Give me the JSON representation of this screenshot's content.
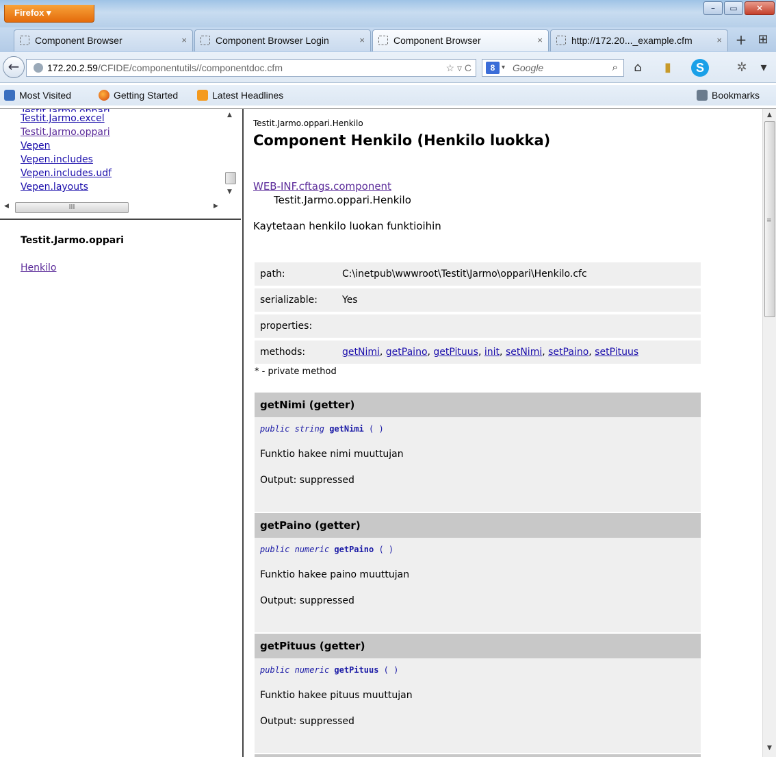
{
  "browser": {
    "menu_button": "Firefox ▾",
    "window_controls": {
      "minimize": "–",
      "maximize": "▭",
      "close": "✕"
    }
  },
  "tabs": [
    {
      "label": "Component Browser",
      "close": "×"
    },
    {
      "label": "Component Browser Login",
      "close": "×"
    },
    {
      "label": "Component Browser",
      "close": "×"
    },
    {
      "label": "http://172.20..._example.cfm",
      "close": "×"
    }
  ],
  "tab_actions": {
    "new_tab": "+",
    "tab_list": "⊞"
  },
  "navbar": {
    "back": "←",
    "url_host": "172.20.2.59",
    "url_path": "/CFIDE/componentutils//componentdoc.cfm",
    "url_icons": "☆ ▿ C",
    "search_engine": "8",
    "search_caret": "▾",
    "search_placeholder": "Google",
    "search_go": "⌕",
    "home": "⌂",
    "bookmark": "▮",
    "skype": "S",
    "ext": "✲",
    "menu_caret": "▾"
  },
  "bookmarks_bar": {
    "most_visited": "Most Visited",
    "getting_started": "Getting Started",
    "latest_headlines": "Latest Headlines",
    "bookmarks": "Bookmarks"
  },
  "packages": [
    {
      "label": "Testit.Jarmo.excel",
      "visited": false
    },
    {
      "label": "Testit.Jarmo.oppari",
      "visited": true
    },
    {
      "label": "Vepen",
      "visited": false
    },
    {
      "label": "Vepen.includes",
      "visited": false
    },
    {
      "label": "Vepen.includes.udf",
      "visited": false
    },
    {
      "label": "Vepen.layouts",
      "visited": false
    }
  ],
  "scroll_glyphs": {
    "up": "▲",
    "down": "▼",
    "left": "◀",
    "right": "▶",
    "grip": "III",
    "vgrip": "≡"
  },
  "class_frame": {
    "package_title": "Testit.Jarmo.oppari",
    "component_link": "Henkilo"
  },
  "doc": {
    "package": "Testit.Jarmo.oppari.Henkilo",
    "title": "Component Henkilo (Henkilo luokka)",
    "parent_link": "WEB-INF.cftags.component",
    "fqcn": "Testit.Jarmo.oppari.Henkilo",
    "description": "Kaytetaan henkilo luokan funktioihin",
    "properties_table": {
      "path_label": "path:",
      "path_value": "C:\\inetpub\\wwwroot\\Testit\\Jarmo\\oppari\\Henkilo.cfc",
      "serializable_label": "serializable:",
      "serializable_value": "Yes",
      "properties_label": "properties:",
      "properties_value": "",
      "methods_label": "methods:",
      "methods": [
        "getNimi",
        "getPaino",
        "getPituus",
        "init",
        "setNimi",
        "setPaino",
        "setPituus"
      ]
    },
    "private_note": "* - private method",
    "methods_detail": [
      {
        "header": "getNimi (getter)",
        "access": "public",
        "returntype": "string",
        "name": "getNimi",
        "params": "( )",
        "description": "Funktio hakee nimi muuttujan",
        "output": "Output: suppressed"
      },
      {
        "header": "getPaino (getter)",
        "access": "public",
        "returntype": "numeric",
        "name": "getPaino",
        "params": "( )",
        "description": "Funktio hakee paino muuttujan",
        "output": "Output: suppressed"
      },
      {
        "header": "getPituus (getter)",
        "access": "public",
        "returntype": "numeric",
        "name": "getPituus",
        "params": "( )",
        "description": "Funktio hakee pituus muuttujan",
        "output": "Output: suppressed"
      }
    ]
  }
}
